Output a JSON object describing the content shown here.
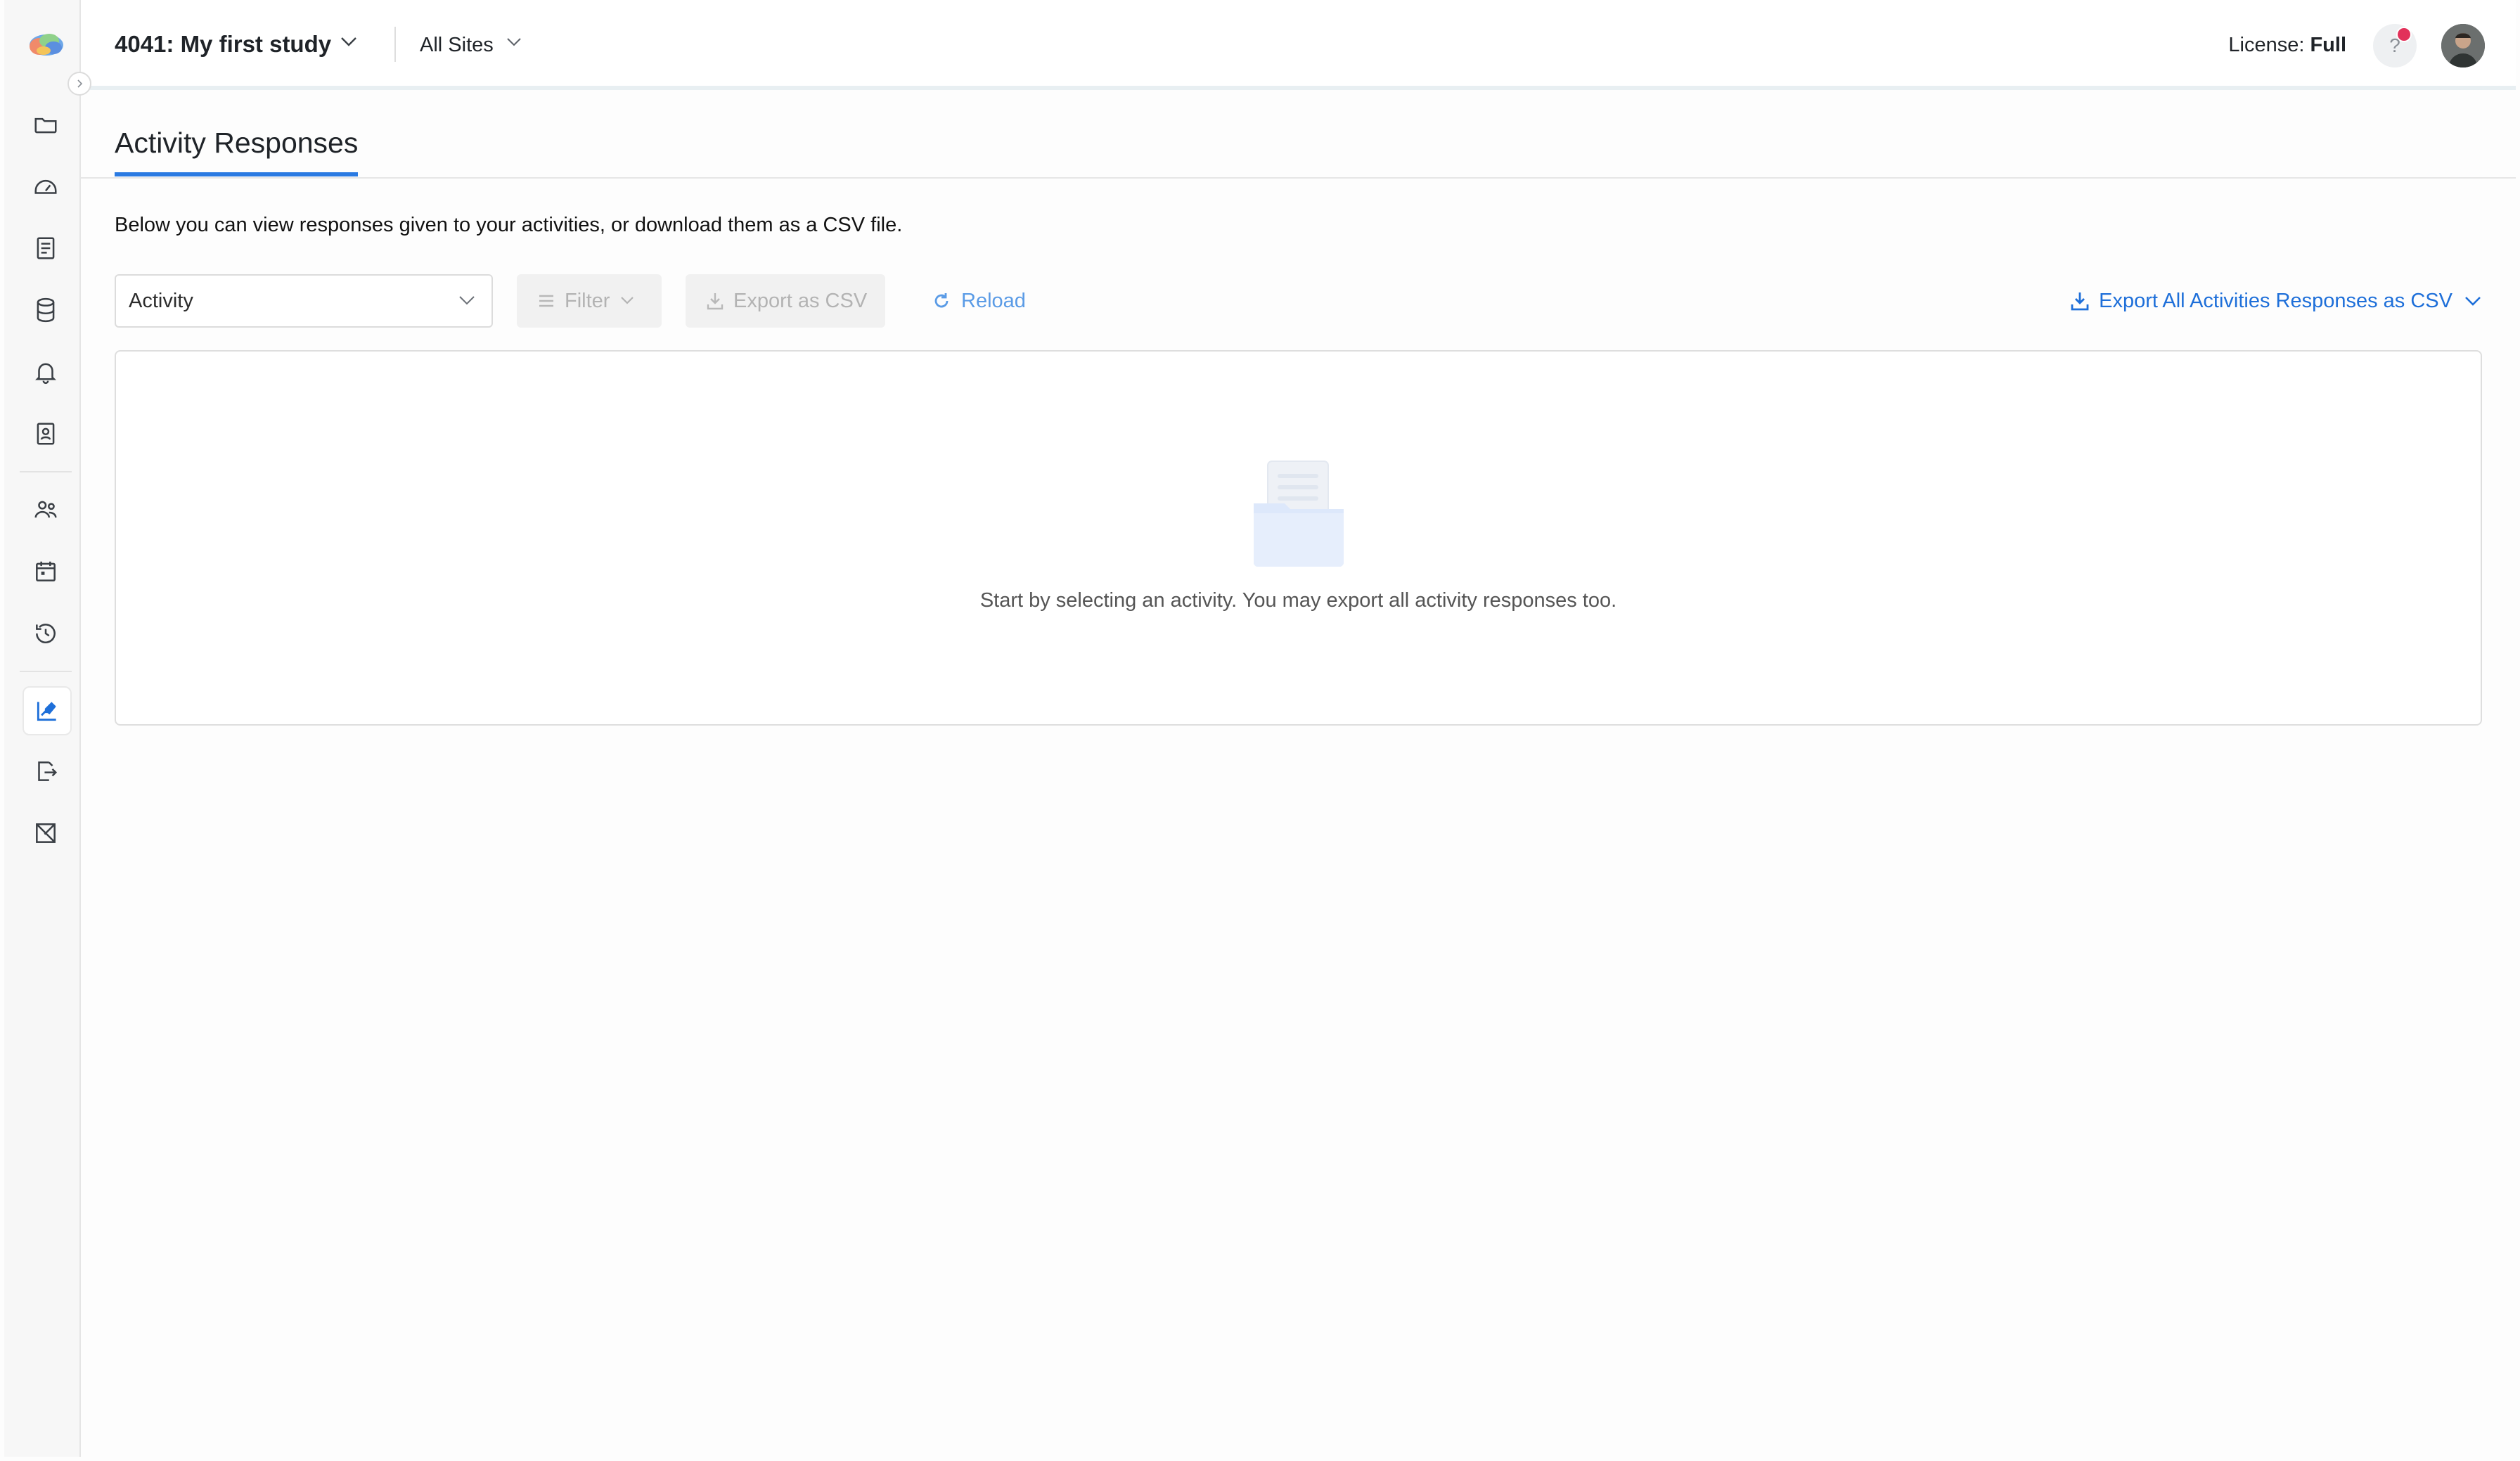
{
  "header": {
    "study_title": "4041: My first study",
    "sites_label": "All Sites",
    "license_label": "License:",
    "license_value": "Full",
    "help_label": "?"
  },
  "sidebar": {
    "items": [
      {
        "name": "folder",
        "icon": "folder-icon"
      },
      {
        "name": "dashboard",
        "icon": "gauge-icon"
      },
      {
        "name": "documents",
        "icon": "document-icon"
      },
      {
        "name": "database",
        "icon": "database-icon"
      },
      {
        "name": "notifications",
        "icon": "bell-icon"
      },
      {
        "name": "contacts",
        "icon": "contact-card-icon"
      },
      {
        "name": "participants",
        "icon": "users-icon"
      },
      {
        "name": "calendar",
        "icon": "calendar-icon"
      },
      {
        "name": "history",
        "icon": "history-icon"
      },
      {
        "name": "activity-responses",
        "icon": "edit-chart-icon",
        "active": true
      },
      {
        "name": "export",
        "icon": "export-icon"
      },
      {
        "name": "formula",
        "icon": "sigma-icon"
      }
    ]
  },
  "main": {
    "tab_label": "Activity Responses",
    "description": "Below you can view responses given to your activities, or download them as a CSV file.",
    "toolbar": {
      "activity_placeholder": "Activity",
      "filter_label": "Filter",
      "export_label": "Export as CSV",
      "reload_label": "Reload",
      "export_all_label": "Export All Activities Responses as CSV"
    },
    "empty_state": {
      "message": "Start by selecting an activity. You may export all activity responses too."
    }
  },
  "colors": {
    "accent": "#2a7ae2",
    "link": "#1e6fd9",
    "notification": "#e2315a",
    "disabled_text": "#b3b3b3"
  }
}
